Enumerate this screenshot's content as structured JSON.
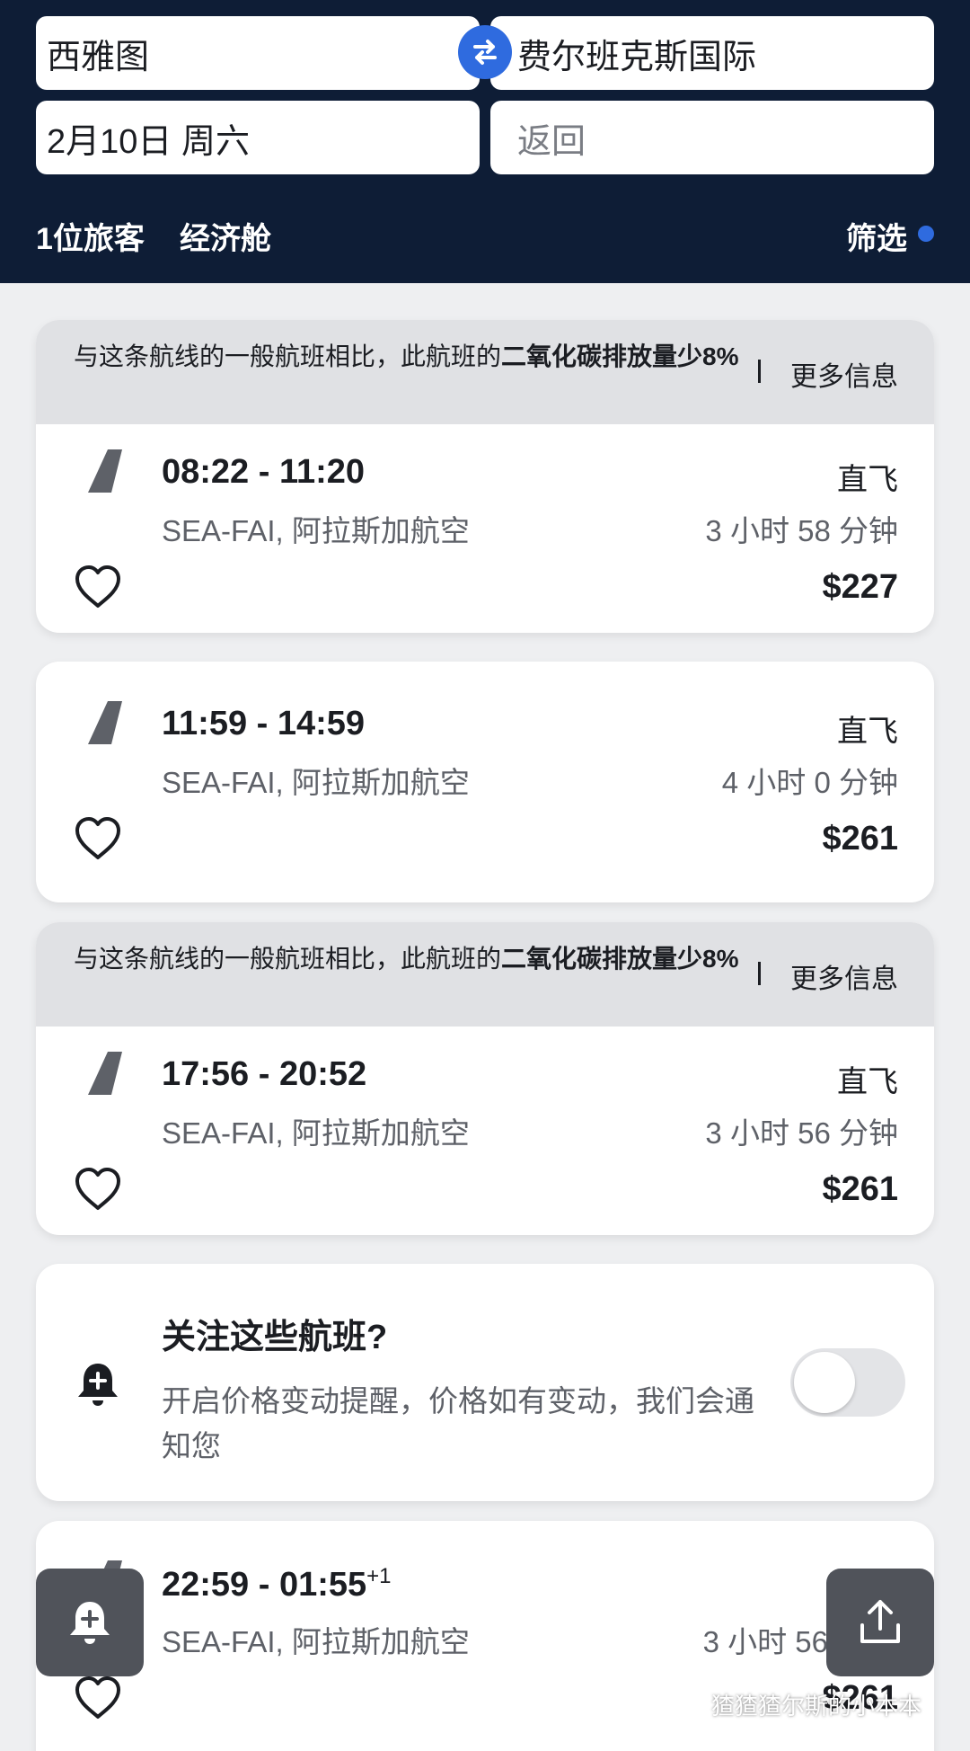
{
  "search": {
    "origin": "西雅图",
    "destination": "费尔班克斯国际",
    "depart_date": "2月10日 周六",
    "return_placeholder": "返回",
    "passengers": "1位旅客",
    "cabin": "经济舱",
    "filter_label": "筛选"
  },
  "eco_banner": {
    "text_prefix": "与这条航线的一般航班相比，此航班的",
    "text_bold": "二氧化碳排放量少8%",
    "more_label": "更多信息"
  },
  "flights": [
    {
      "time": "08:22 - 11:20",
      "route": "SEA-FAI, 阿拉斯加航空",
      "stops": "直飞",
      "duration": "3 小时 58 分钟",
      "price": "$227"
    },
    {
      "time": "11:59 - 14:59",
      "route": "SEA-FAI, 阿拉斯加航空",
      "stops": "直飞",
      "duration": "4 小时 0 分钟",
      "price": "$261"
    },
    {
      "time": "17:56 - 20:52",
      "route": "SEA-FAI, 阿拉斯加航空",
      "stops": "直飞",
      "duration": "3 小时 56 分钟",
      "price": "$261"
    },
    {
      "time": "22:59 - 01:55",
      "time_suffix": "+1",
      "route": "SEA-FAI, 阿拉斯加航空",
      "duration": "3 小时 56",
      "price": "$261"
    }
  ],
  "price_alert": {
    "title": "关注这些航班?",
    "body": "开启价格变动提醒，价格如有变动，我们会通知您",
    "enabled": false
  },
  "watermark": "猹猹猹尔斯的小本本",
  "colors": {
    "header_bg": "#0e1d36",
    "accent": "#2f6bdf",
    "fab_bg": "#50535a"
  }
}
